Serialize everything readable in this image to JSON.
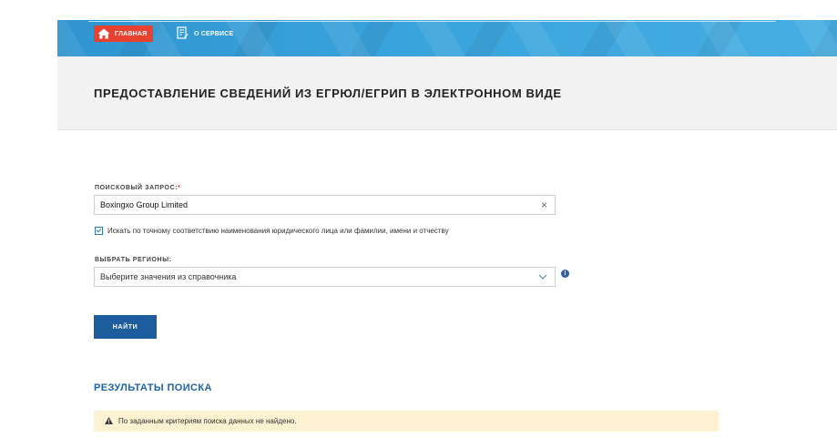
{
  "nav": {
    "home_label": "ГЛАВНАЯ",
    "about_label": "О СЕРВИСЕ"
  },
  "page": {
    "title": "ПРЕДОСТАВЛЕНИЕ СВЕДЕНИЙ ИЗ ЕГРЮЛ/ЕГРИП В ЭЛЕКТРОННОМ ВИДЕ"
  },
  "search": {
    "label": "ПОИСКОВЫЙ ЗАПРОС:",
    "required_mark": "*",
    "value": "Boxingxo Group Limited",
    "clear_symbol": "×",
    "exact_match_checked": true,
    "exact_match_label": "Искать по точному соответствию наименования юридического лица или фамилии, имени и отчеству"
  },
  "regions": {
    "label": "ВЫБРАТЬ РЕГИОНЫ:",
    "placeholder": "Выберите значения из справочника",
    "info_symbol": "i"
  },
  "actions": {
    "find_label": "НАЙТИ"
  },
  "results": {
    "title": "РЕЗУЛЬТАТЫ ПОИСКА",
    "message": "По заданным критериям поиска данных не найдено."
  },
  "colors": {
    "nav_blue": "#3aa3dc",
    "home_red": "#e8412f",
    "button_blue": "#1d5c9d",
    "results_title_blue": "#1d63a8",
    "alert_bg": "#fcf2d2"
  },
  "icons": [
    "home-icon",
    "document-icon",
    "clear-icon",
    "chevron-down-icon",
    "info-icon",
    "warning-icon",
    "checkbox-checked"
  ]
}
